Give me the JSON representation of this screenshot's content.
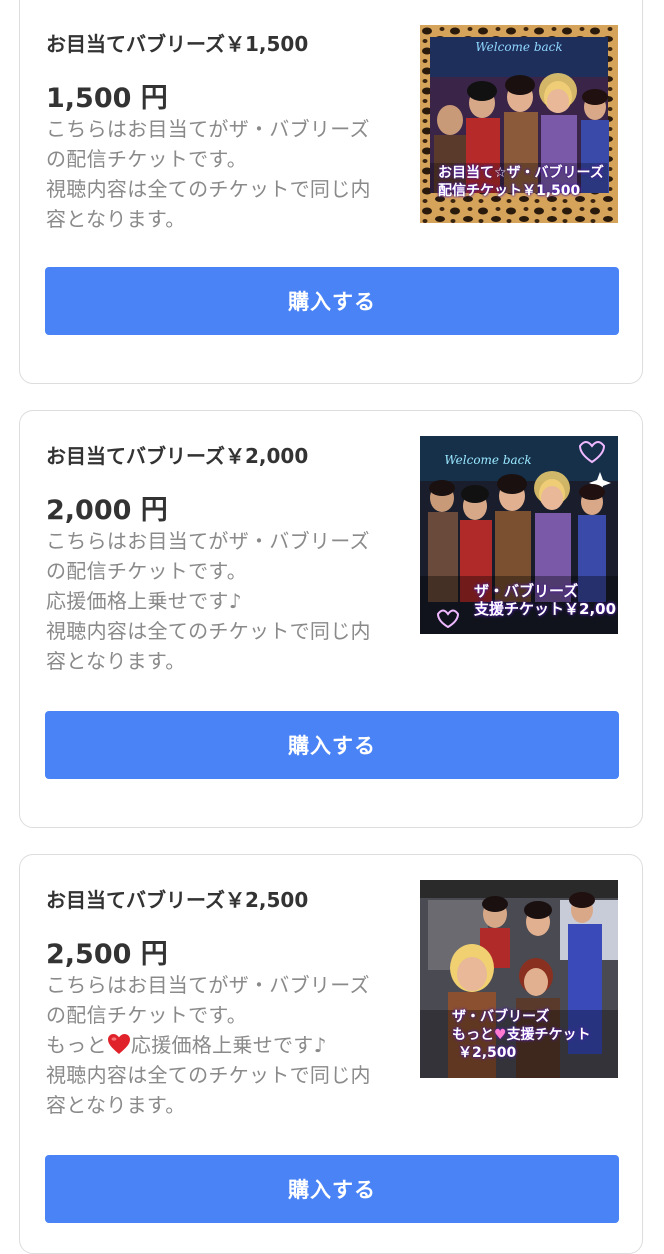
{
  "colors": {
    "button": "#4a83f6",
    "title": "#333333",
    "description": "#8a8a8a",
    "card_border": "#dddddd",
    "heart": "#e0232b"
  },
  "tickets": [
    {
      "title": "お目当てバブリーズ￥1,500",
      "price": "1,500 円",
      "description_lines": [
        "こちらはお目当てがザ・バブリーズ",
        "の配信チケットです。",
        "視聴内容は全てのチケットで同じ内",
        "容となります。"
      ],
      "image": {
        "sign_text": "Welcome back",
        "caption_lines": [
          "お目当て☆ザ・バブリーズ",
          "配信チケット￥1,500"
        ]
      },
      "button_label": "購入する"
    },
    {
      "title": "お目当てバブリーズ￥2,000",
      "price": "2,000 円",
      "description_lines": [
        "こちらはお目当てがザ・バブリーズ",
        "の配信チケットです。",
        "応援価格上乗せです♪",
        "視聴内容は全てのチケットで同じ内",
        "容となります。"
      ],
      "image": {
        "sign_text": "Welcome back",
        "caption_lines": [
          "ザ・バブリーズ",
          "支援チケット￥2,00"
        ]
      },
      "button_label": "購入する"
    },
    {
      "title": "お目当てバブリーズ￥2,500",
      "price": "2,500 円",
      "description_lines": [
        "こちらはお目当てがザ・バブリーズ",
        "の配信チケットです。",
        "もっと",
        "応援価格上乗せです♪",
        "視聴内容は全てのチケットで同じ内",
        "容となります。"
      ],
      "description_icon": "heart-icon",
      "image": {
        "caption_lines": [
          "ザ・バブリーズ",
          "もっと",
          "支援チケット",
          "￥2,500"
        ]
      },
      "button_label": "購入する"
    }
  ]
}
